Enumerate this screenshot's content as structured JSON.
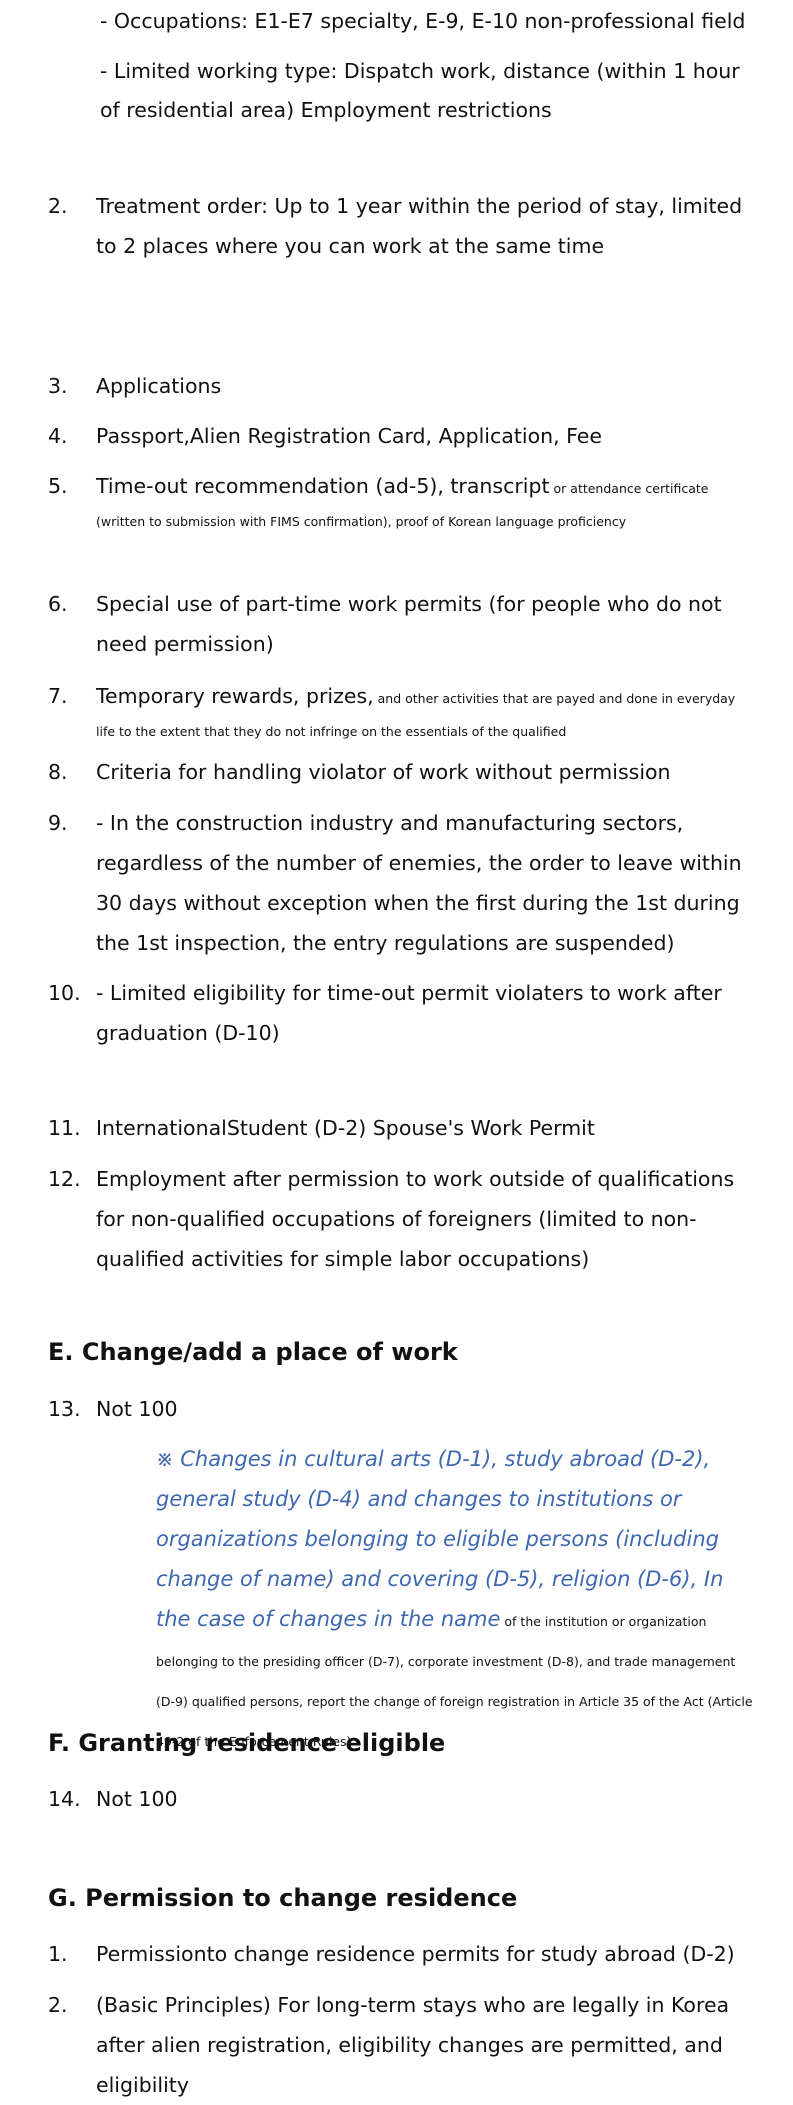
{
  "intro_lines": {
    "occupations": "- Occupations: E1-E7 specialty, E-9, E-10 non-professional field",
    "limited_type": "- Limited working type: Dispatch work, distance (within 1 hour of residential area) Employment restrictions"
  },
  "items": [
    {
      "num": "2.",
      "text": "Treatment order: Up to 1 year within the period of stay, limited to 2 places where you can work at the same time"
    },
    {
      "num": "3.",
      "text": "Applications"
    },
    {
      "num": "4.",
      "text": "Passport,Alien Registration Card, Application, Fee"
    },
    {
      "num": "5.",
      "text": "Time-out recommendation (ad-5), transcript",
      "small": " or attendance certificate (written to submission with FIMS confirmation), proof of Korean language proficiency"
    },
    {
      "num": "6.",
      "text": "Special use of part-time work permits (for people who do not need permission)"
    },
    {
      "num": "7.",
      "text": "Temporary rewards, prizes,",
      "small": " and other activities that are payed and done in everyday life to the extent that they do not infringe on the essentials of the qualified"
    },
    {
      "num": "8.",
      "text": "Criteria for handling violator of work without permission"
    },
    {
      "num": "9.",
      "text": "- In the construction industry and manufacturing sectors, regardless of the number of enemies, the order to leave within 30 days without exception when the first during the 1st during the 1st inspection, the entry regulations are suspended)"
    },
    {
      "num": "10.",
      "text": "- Limited eligibility for time-out permit violaters to work after graduation (D-10)"
    },
    {
      "num": "11.",
      "text": "InternationalStudent (D-2) Spouse's Work Permit"
    },
    {
      "num": "12.",
      "text": "Employment after permission to work outside of qualifications for non-qualified occupations of foreigners (limited to non-qualified activities for simple labor occupations)"
    }
  ],
  "section_e": {
    "heading": "E. Change/add a place of work",
    "item": {
      "num": "13.",
      "text": "Not 100"
    },
    "note_italic": "※ Changes in cultural arts (D-1), study abroad (D-2), general study (D-4) and changes to institutions or organizations belonging to eligible persons (including change of name) and covering (D-5), religion (D-6), In the case of changes in the name",
    "note_small": " of the institution or organization belonging to the presiding officer (D-7), corporate investment (D-8), and trade management (D-9) qualified persons, report the change of foreign registration in Article 35 of the Act (Article 49-2 of the Enforcement Rules)"
  },
  "section_f": {
    "heading": "F. Granting residence eligible",
    "item": {
      "num": "14.",
      "text": "Not 100"
    }
  },
  "section_g": {
    "heading": "G. Permission to change residence",
    "items": [
      {
        "num": "1.",
        "text": "Permissionto change residence permits for study abroad (D-2)"
      },
      {
        "num": "2.",
        "text": "(Basic Principles) For long-term stays who are legally in Korea after alien registration, eligibility changes are permitted, and eligibility"
      }
    ]
  },
  "colors": {
    "note_blue": "#3e68b0",
    "text": "#111111"
  }
}
